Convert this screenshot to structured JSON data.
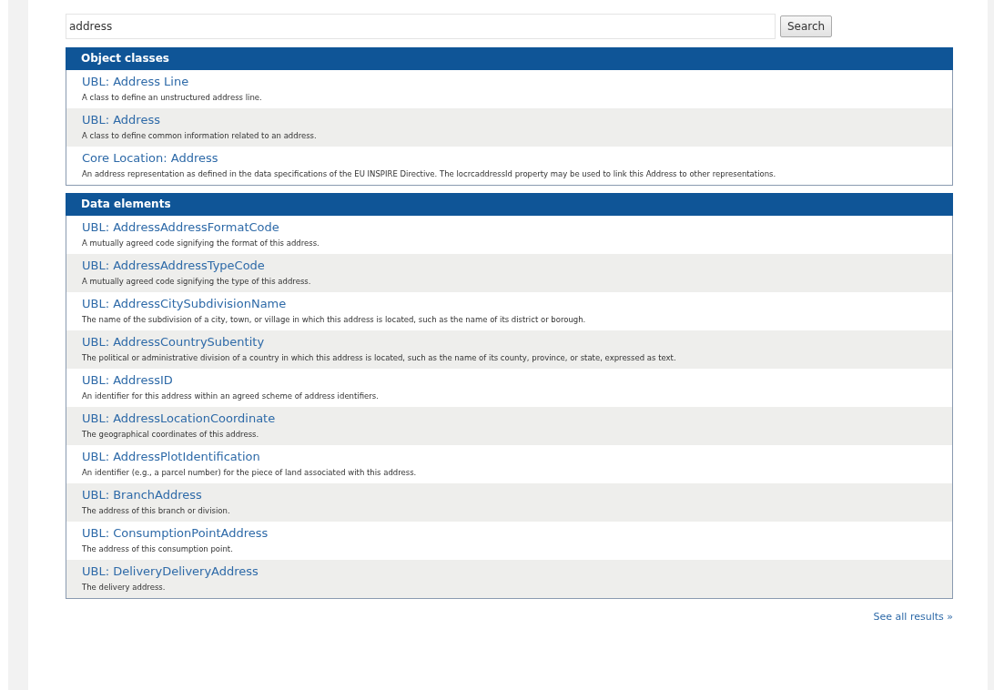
{
  "search": {
    "value": "address",
    "button": "Search"
  },
  "sections": [
    {
      "title": "Object classes",
      "items": [
        {
          "title": "UBL: Address Line",
          "description": "A class to define an unstructured address line."
        },
        {
          "title": "UBL: Address",
          "description": "A class to define common information related to an address."
        },
        {
          "title": "Core Location: Address",
          "description": "An address representation as defined in the data specifications of the EU INSPIRE Directive. The locrcaddressId property may be used to link this Address to other representations."
        }
      ]
    },
    {
      "title": "Data elements",
      "items": [
        {
          "title": "UBL: AddressAddressFormatCode",
          "description": "A mutually agreed code signifying the format of this address."
        },
        {
          "title": "UBL: AddressAddressTypeCode",
          "description": "A mutually agreed code signifying the type of this address."
        },
        {
          "title": "UBL: AddressCitySubdivisionName",
          "description": "The name of the subdivision of a city, town, or village in which this address is located, such as the name of its district or borough."
        },
        {
          "title": "UBL: AddressCountrySubentity",
          "description": "The political or administrative division of a country in which this address is located, such as the name of its county, province, or state, expressed as text."
        },
        {
          "title": "UBL: AddressID",
          "description": "An identifier for this address within an agreed scheme of address identifiers."
        },
        {
          "title": "UBL: AddressLocationCoordinate",
          "description": "The geographical coordinates of this address."
        },
        {
          "title": "UBL: AddressPlotIdentification",
          "description": "An identifier (e.g., a parcel number) for the piece of land associated with this address."
        },
        {
          "title": "UBL: BranchAddress",
          "description": "The address of this branch or division."
        },
        {
          "title": "UBL: ConsumptionPointAddress",
          "description": "The address of this consumption point."
        },
        {
          "title": "UBL: DeliveryDeliveryAddress",
          "description": "The delivery address."
        }
      ]
    }
  ],
  "see_all": "See all results »"
}
